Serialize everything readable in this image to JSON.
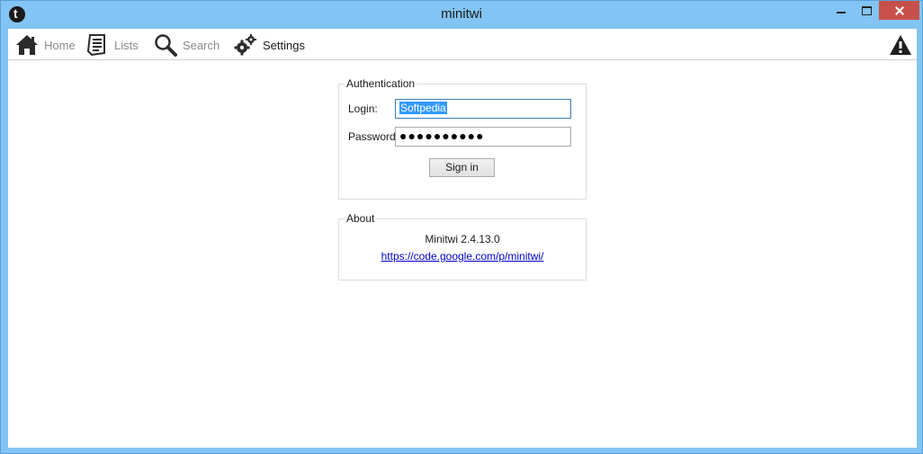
{
  "window": {
    "title": "minitwi"
  },
  "toolbar": {
    "items": [
      {
        "label": "Home",
        "icon": "home-icon"
      },
      {
        "label": "Lists",
        "icon": "lists-icon"
      },
      {
        "label": "Search",
        "icon": "search-icon"
      },
      {
        "label": "Settings",
        "icon": "settings-icon",
        "active": true
      }
    ],
    "right_icon": "warning-icon"
  },
  "authentication": {
    "title": "Authentication",
    "login_label": "Login:",
    "login_value": "Softpedia",
    "password_label": "Password:",
    "password_value": "●●●●●●●●●●",
    "signin_label": "Sign in"
  },
  "about": {
    "title": "About",
    "version": "Minitwi 2.4.13.0",
    "link": "https://code.google.com/p/minitwi/"
  },
  "colors": {
    "titlebar": "#82c4f3",
    "close_button": "#c7504a",
    "selection": "#3399ff",
    "link": "#0000cc"
  }
}
